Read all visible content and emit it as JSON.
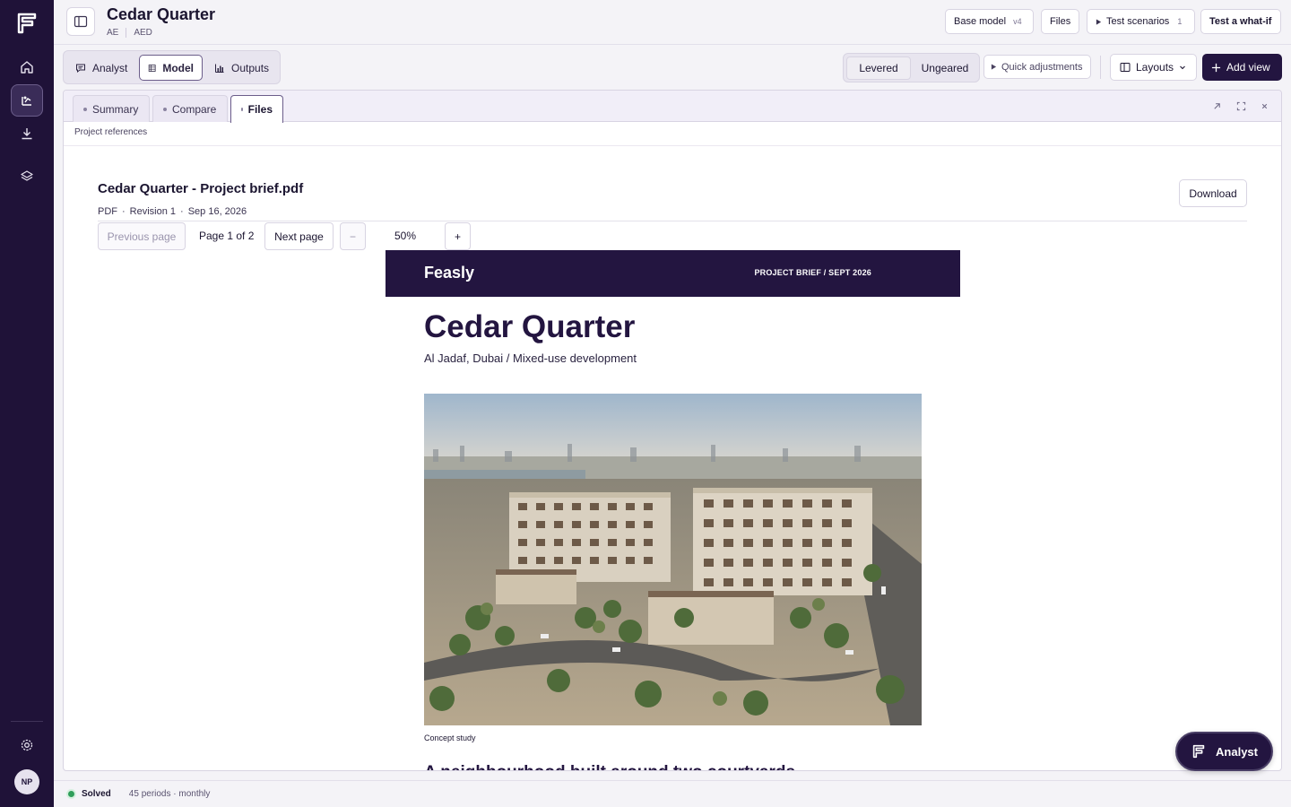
{
  "project": {
    "title": "Cedar Quarter",
    "country": "AE",
    "currency": "AED"
  },
  "header": {
    "base_model_label": "Base model",
    "base_model_version": "v4",
    "files_label": "Files",
    "test_scenarios_label": "Test scenarios",
    "test_scenarios_count": "1",
    "what_if_label": "Test a what-if"
  },
  "view_tabs": [
    {
      "label": "Analyst",
      "icon": "chat-icon",
      "active": false
    },
    {
      "label": "Model",
      "icon": "table-icon",
      "active": true
    },
    {
      "label": "Outputs",
      "icon": "bar-chart-icon",
      "active": false
    }
  ],
  "leverage": {
    "levered_label": "Levered",
    "ungeared_label": "Ungeared",
    "selected": "Levered"
  },
  "toolbar": {
    "quick_adjustments_label": "Quick adjustments",
    "layouts_label": "Layouts",
    "add_view_label": "Add view"
  },
  "panel": {
    "tabs": [
      {
        "label": "Summary",
        "active": false
      },
      {
        "label": "Compare",
        "active": false
      },
      {
        "label": "Files",
        "active": true
      }
    ],
    "subheading": "Project references"
  },
  "file": {
    "name": "Cedar Quarter - Project brief.pdf",
    "type": "PDF",
    "revision": "Revision 1",
    "date": "Sep 16, 2026",
    "download_label": "Download"
  },
  "pager": {
    "prev_label": "Previous page",
    "page_text": "Page 1 of 2",
    "next_label": "Next page",
    "zoom_out": "−",
    "zoom_level": "50%",
    "zoom_in": "+"
  },
  "document": {
    "brand": "Feasly",
    "tag": "PROJECT BRIEF  /  SEPT 2026",
    "title": "Cedar Quarter",
    "subtitle": "Al Jadaf, Dubai  /  Mixed-use development",
    "caption": "Concept study",
    "section_heading": "A neighbourhood built around two courtyards"
  },
  "fab": {
    "label": "Analyst"
  },
  "status": {
    "state": "Solved",
    "periods": "45 periods · monthly"
  },
  "user": {
    "initials": "NP"
  },
  "colors": {
    "rail": "#1f1238",
    "primary": "#231540",
    "accent_border": "#6b5d8a",
    "solved": "#2f9e5a"
  },
  "icons": [
    "brand-logo-icon",
    "home-icon",
    "model-icon",
    "download-icon",
    "layers-icon",
    "settings-icon",
    "sidebar-toggle-icon",
    "play-icon",
    "layout-icon",
    "chevron-down-icon",
    "plus-icon",
    "external-link-icon",
    "fullscreen-icon",
    "close-icon"
  ]
}
